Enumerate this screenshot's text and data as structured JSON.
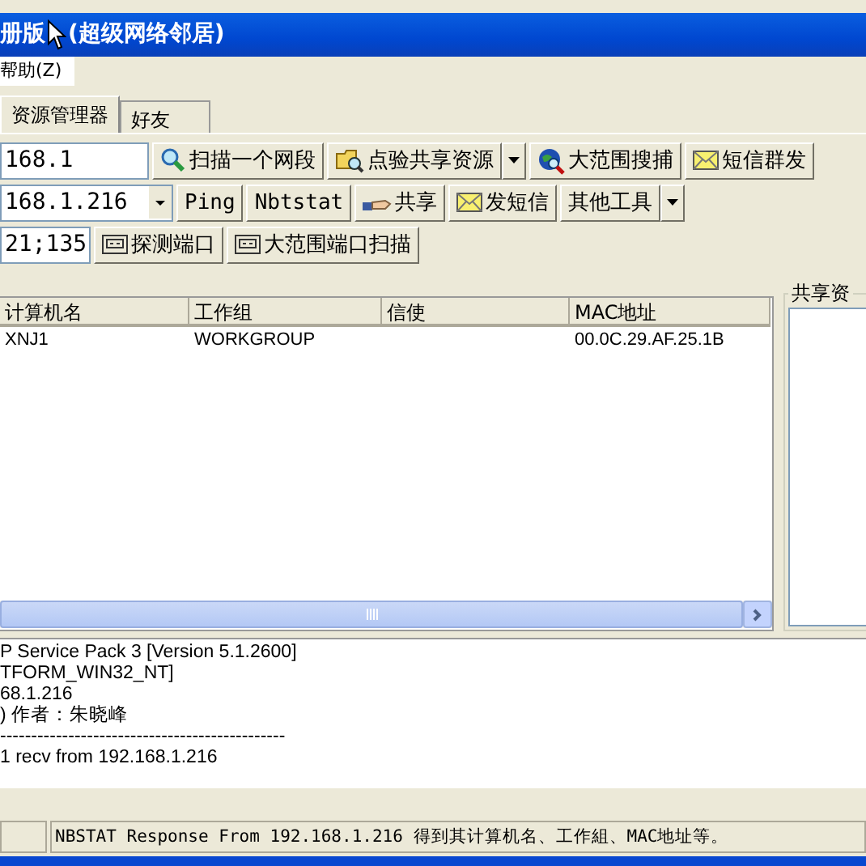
{
  "window": {
    "title_parts": [
      "册版",
      "(超级网络邻居)"
    ]
  },
  "menu": [
    {
      "label": "帮助(Z)"
    }
  ],
  "tabs": [
    {
      "label": "资源管理器",
      "selected": true
    },
    {
      "label": "好友",
      "selected": false
    }
  ],
  "toolbar_rows": [
    {
      "field": {
        "value": "168.1",
        "kind": "input"
      },
      "buttons": [
        {
          "label": "扫描一个网段",
          "kind": "scan"
        },
        {
          "label": "点验共享资源",
          "kind": "share-scan",
          "dropdown": true
        },
        {
          "label": "大范围搜捕",
          "kind": "wide-scan"
        },
        {
          "label": "短信群发",
          "kind": "message"
        }
      ]
    },
    {
      "field": {
        "value": "168.1.216",
        "kind": "combo"
      },
      "buttons": [
        {
          "label": "Ping",
          "kind": "plain"
        },
        {
          "label": "Nbtstat",
          "kind": "plain"
        },
        {
          "label": "共享",
          "kind": "share"
        },
        {
          "label": "发短信",
          "kind": "message"
        },
        {
          "label": "其他工具",
          "kind": "plain",
          "dropdown": true
        }
      ]
    },
    {
      "field": {
        "value": "21;135",
        "kind": "input"
      },
      "buttons": [
        {
          "label": "探测端口",
          "kind": "port"
        },
        {
          "label": "大范围端口扫描",
          "kind": "port"
        }
      ]
    }
  ],
  "table": {
    "columns": [
      "计算机名",
      "工作组",
      "信使",
      "MAC地址"
    ],
    "rows": [
      {
        "cells": [
          "XNJ1",
          "WORKGROUP",
          "",
          "00.0C.29.AF.25.1B"
        ]
      }
    ]
  },
  "side_panel": {
    "title": "共享资"
  },
  "log": [
    "P Service Pack 3 [Version 5.1.2600]",
    "TFORM_WIN32_NT]",
    "68.1.216",
    ") 作者：朱晓峰",
    "----------------------------------------------",
    "1 recv from 192.168.1.216"
  ],
  "status_bar": {
    "text": "NBSTAT Response From 192.168.1.216 得到其计算机名、工作組、MAC地址等。"
  }
}
